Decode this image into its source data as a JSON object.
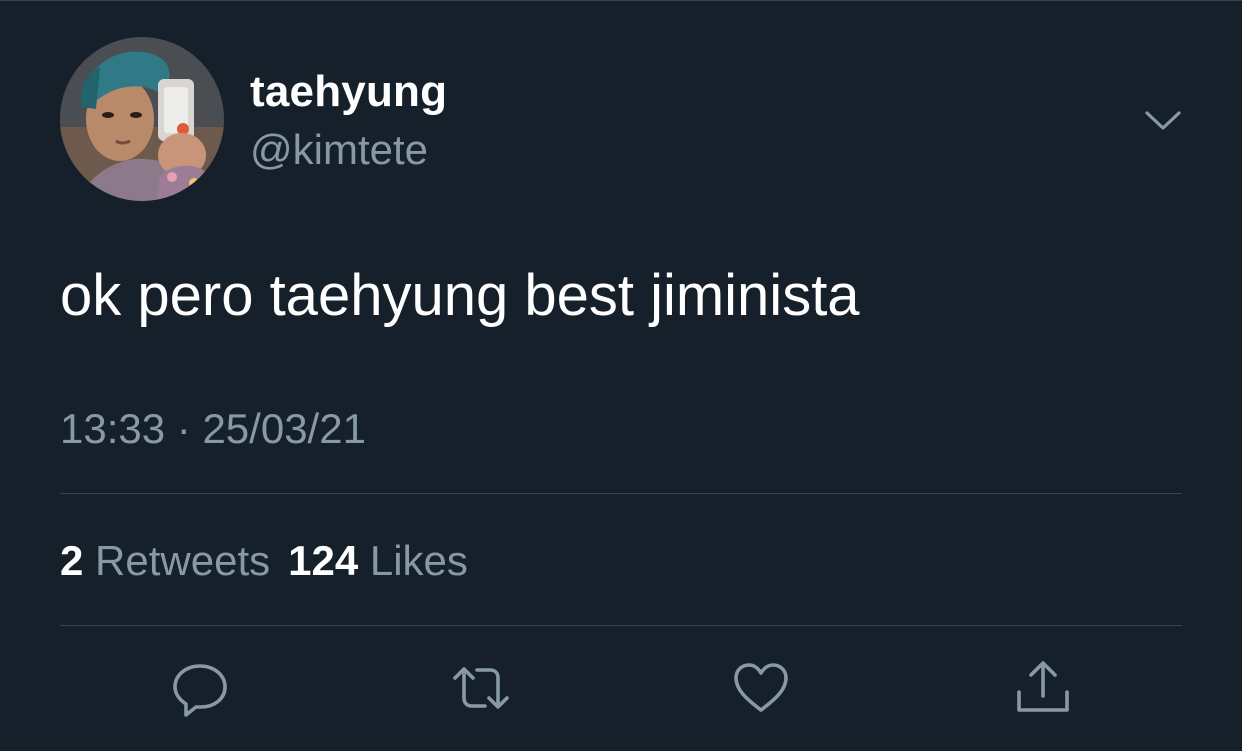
{
  "user": {
    "display_name": "taehyung",
    "handle": "@kimtete"
  },
  "tweet": {
    "text": "ok pero taehyung best jiminista",
    "time": "13:33",
    "separator": "·",
    "date": "25/03/21"
  },
  "stats": {
    "retweets_count": "2",
    "retweets_label": "Retweets",
    "likes_count": "124",
    "likes_label": "Likes"
  },
  "icons": {
    "menu": "chevron-down-icon",
    "reply": "reply-icon",
    "retweet": "retweet-icon",
    "like": "heart-icon",
    "share": "share-icon"
  },
  "colors": {
    "background": "#15202b",
    "primary_text": "#ffffff",
    "secondary_text": "#8899a6",
    "divider": "#38444d"
  }
}
